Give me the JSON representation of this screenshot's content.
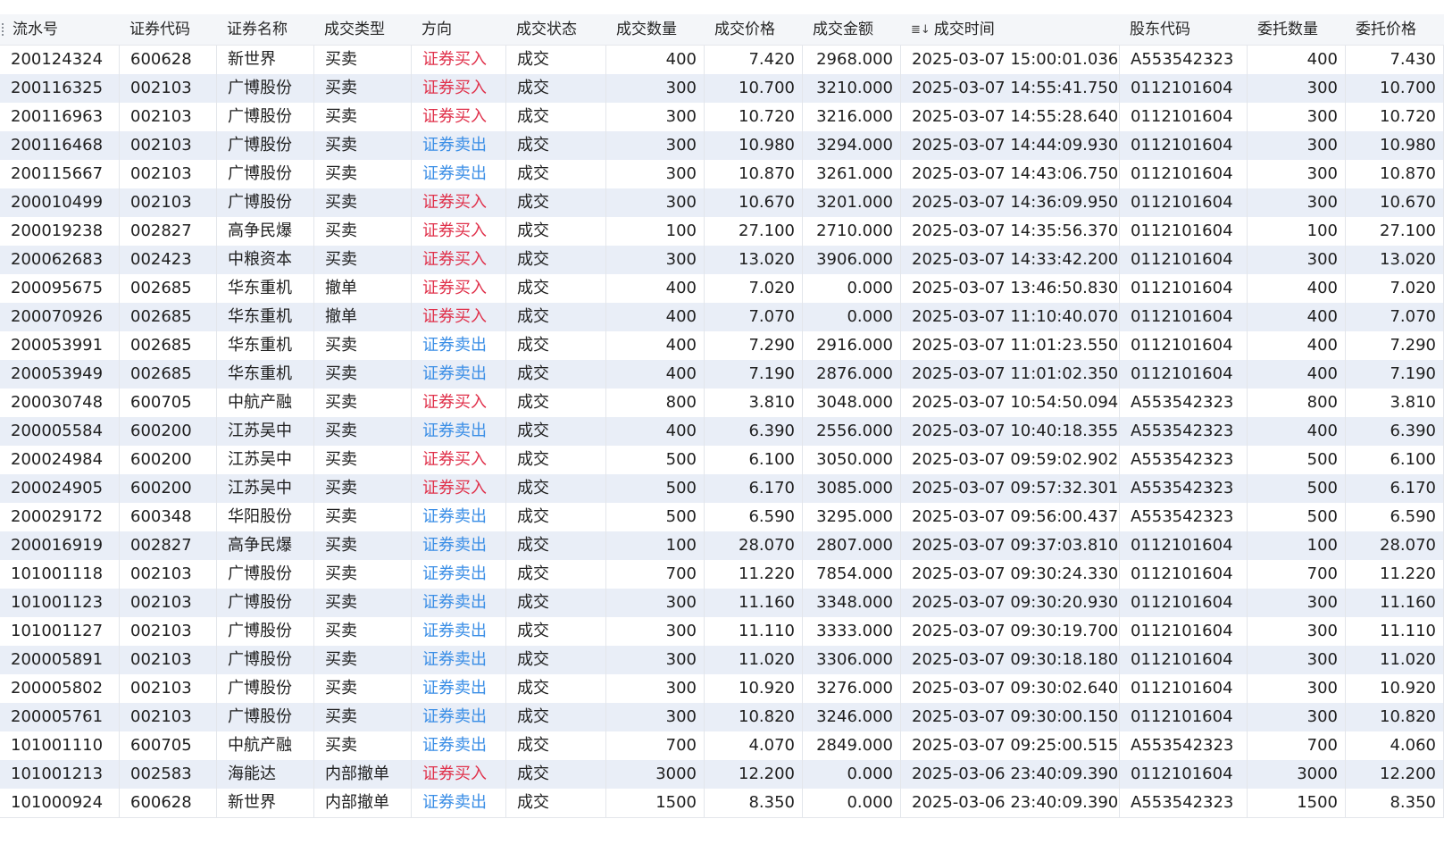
{
  "colors": {
    "buy": "#e0314b",
    "sell": "#3a8ee6",
    "stripe": "#e9eef7",
    "header_bg": "#f4f6f9"
  },
  "table": {
    "sort_icon": "sort-descending-icon",
    "headers": [
      "流水号",
      "证券代码",
      "证券名称",
      "成交类型",
      "方向",
      "成交状态",
      "成交数量",
      "成交价格",
      "成交金额",
      "成交时间",
      "股东代码",
      "委托数量",
      "委托价格"
    ],
    "rows": [
      [
        "200124324",
        "600628",
        "新世界",
        "买卖",
        "证券买入",
        "成交",
        "400",
        "7.420",
        "2968.000",
        "2025-03-07 15:00:01.036",
        "A553542323",
        "400",
        "7.430"
      ],
      [
        "200116325",
        "002103",
        "广博股份",
        "买卖",
        "证券买入",
        "成交",
        "300",
        "10.700",
        "3210.000",
        "2025-03-07 14:55:41.750",
        "0112101604",
        "300",
        "10.700"
      ],
      [
        "200116963",
        "002103",
        "广博股份",
        "买卖",
        "证券买入",
        "成交",
        "300",
        "10.720",
        "3216.000",
        "2025-03-07 14:55:28.640",
        "0112101604",
        "300",
        "10.720"
      ],
      [
        "200116468",
        "002103",
        "广博股份",
        "买卖",
        "证券卖出",
        "成交",
        "300",
        "10.980",
        "3294.000",
        "2025-03-07 14:44:09.930",
        "0112101604",
        "300",
        "10.980"
      ],
      [
        "200115667",
        "002103",
        "广博股份",
        "买卖",
        "证券卖出",
        "成交",
        "300",
        "10.870",
        "3261.000",
        "2025-03-07 14:43:06.750",
        "0112101604",
        "300",
        "10.870"
      ],
      [
        "200010499",
        "002103",
        "广博股份",
        "买卖",
        "证券买入",
        "成交",
        "300",
        "10.670",
        "3201.000",
        "2025-03-07 14:36:09.950",
        "0112101604",
        "300",
        "10.670"
      ],
      [
        "200019238",
        "002827",
        "高争民爆",
        "买卖",
        "证券买入",
        "成交",
        "100",
        "27.100",
        "2710.000",
        "2025-03-07 14:35:56.370",
        "0112101604",
        "100",
        "27.100"
      ],
      [
        "200062683",
        "002423",
        "中粮资本",
        "买卖",
        "证券买入",
        "成交",
        "300",
        "13.020",
        "3906.000",
        "2025-03-07 14:33:42.200",
        "0112101604",
        "300",
        "13.020"
      ],
      [
        "200095675",
        "002685",
        "华东重机",
        "撤单",
        "证券买入",
        "成交",
        "400",
        "7.020",
        "0.000",
        "2025-03-07 13:46:50.830",
        "0112101604",
        "400",
        "7.020"
      ],
      [
        "200070926",
        "002685",
        "华东重机",
        "撤单",
        "证券买入",
        "成交",
        "400",
        "7.070",
        "0.000",
        "2025-03-07 11:10:40.070",
        "0112101604",
        "400",
        "7.070"
      ],
      [
        "200053991",
        "002685",
        "华东重机",
        "买卖",
        "证券卖出",
        "成交",
        "400",
        "7.290",
        "2916.000",
        "2025-03-07 11:01:23.550",
        "0112101604",
        "400",
        "7.290"
      ],
      [
        "200053949",
        "002685",
        "华东重机",
        "买卖",
        "证券卖出",
        "成交",
        "400",
        "7.190",
        "2876.000",
        "2025-03-07 11:01:02.350",
        "0112101604",
        "400",
        "7.190"
      ],
      [
        "200030748",
        "600705",
        "中航产融",
        "买卖",
        "证券买入",
        "成交",
        "800",
        "3.810",
        "3048.000",
        "2025-03-07 10:54:50.094",
        "A553542323",
        "800",
        "3.810"
      ],
      [
        "200005584",
        "600200",
        "江苏吴中",
        "买卖",
        "证券卖出",
        "成交",
        "400",
        "6.390",
        "2556.000",
        "2025-03-07 10:40:18.355",
        "A553542323",
        "400",
        "6.390"
      ],
      [
        "200024984",
        "600200",
        "江苏吴中",
        "买卖",
        "证券买入",
        "成交",
        "500",
        "6.100",
        "3050.000",
        "2025-03-07 09:59:02.902",
        "A553542323",
        "500",
        "6.100"
      ],
      [
        "200024905",
        "600200",
        "江苏吴中",
        "买卖",
        "证券买入",
        "成交",
        "500",
        "6.170",
        "3085.000",
        "2025-03-07 09:57:32.301",
        "A553542323",
        "500",
        "6.170"
      ],
      [
        "200029172",
        "600348",
        "华阳股份",
        "买卖",
        "证券卖出",
        "成交",
        "500",
        "6.590",
        "3295.000",
        "2025-03-07 09:56:00.437",
        "A553542323",
        "500",
        "6.590"
      ],
      [
        "200016919",
        "002827",
        "高争民爆",
        "买卖",
        "证券卖出",
        "成交",
        "100",
        "28.070",
        "2807.000",
        "2025-03-07 09:37:03.810",
        "0112101604",
        "100",
        "28.070"
      ],
      [
        "101001118",
        "002103",
        "广博股份",
        "买卖",
        "证券卖出",
        "成交",
        "700",
        "11.220",
        "7854.000",
        "2025-03-07 09:30:24.330",
        "0112101604",
        "700",
        "11.220"
      ],
      [
        "101001123",
        "002103",
        "广博股份",
        "买卖",
        "证券卖出",
        "成交",
        "300",
        "11.160",
        "3348.000",
        "2025-03-07 09:30:20.930",
        "0112101604",
        "300",
        "11.160"
      ],
      [
        "101001127",
        "002103",
        "广博股份",
        "买卖",
        "证券卖出",
        "成交",
        "300",
        "11.110",
        "3333.000",
        "2025-03-07 09:30:19.700",
        "0112101604",
        "300",
        "11.110"
      ],
      [
        "200005891",
        "002103",
        "广博股份",
        "买卖",
        "证券卖出",
        "成交",
        "300",
        "11.020",
        "3306.000",
        "2025-03-07 09:30:18.180",
        "0112101604",
        "300",
        "11.020"
      ],
      [
        "200005802",
        "002103",
        "广博股份",
        "买卖",
        "证券卖出",
        "成交",
        "300",
        "10.920",
        "3276.000",
        "2025-03-07 09:30:02.640",
        "0112101604",
        "300",
        "10.920"
      ],
      [
        "200005761",
        "002103",
        "广博股份",
        "买卖",
        "证券卖出",
        "成交",
        "300",
        "10.820",
        "3246.000",
        "2025-03-07 09:30:00.150",
        "0112101604",
        "300",
        "10.820"
      ],
      [
        "101001110",
        "600705",
        "中航产融",
        "买卖",
        "证券卖出",
        "成交",
        "700",
        "4.070",
        "2849.000",
        "2025-03-07 09:25:00.515",
        "A553542323",
        "700",
        "4.060"
      ],
      [
        "101001213",
        "002583",
        "海能达",
        "内部撤单",
        "证券买入",
        "成交",
        "3000",
        "12.200",
        "0.000",
        "2025-03-06 23:40:09.390",
        "0112101604",
        "3000",
        "12.200"
      ],
      [
        "101000924",
        "600628",
        "新世界",
        "内部撤单",
        "证券卖出",
        "成交",
        "1500",
        "8.350",
        "0.000",
        "2025-03-06 23:40:09.390",
        "A553542323",
        "1500",
        "8.350"
      ]
    ]
  }
}
